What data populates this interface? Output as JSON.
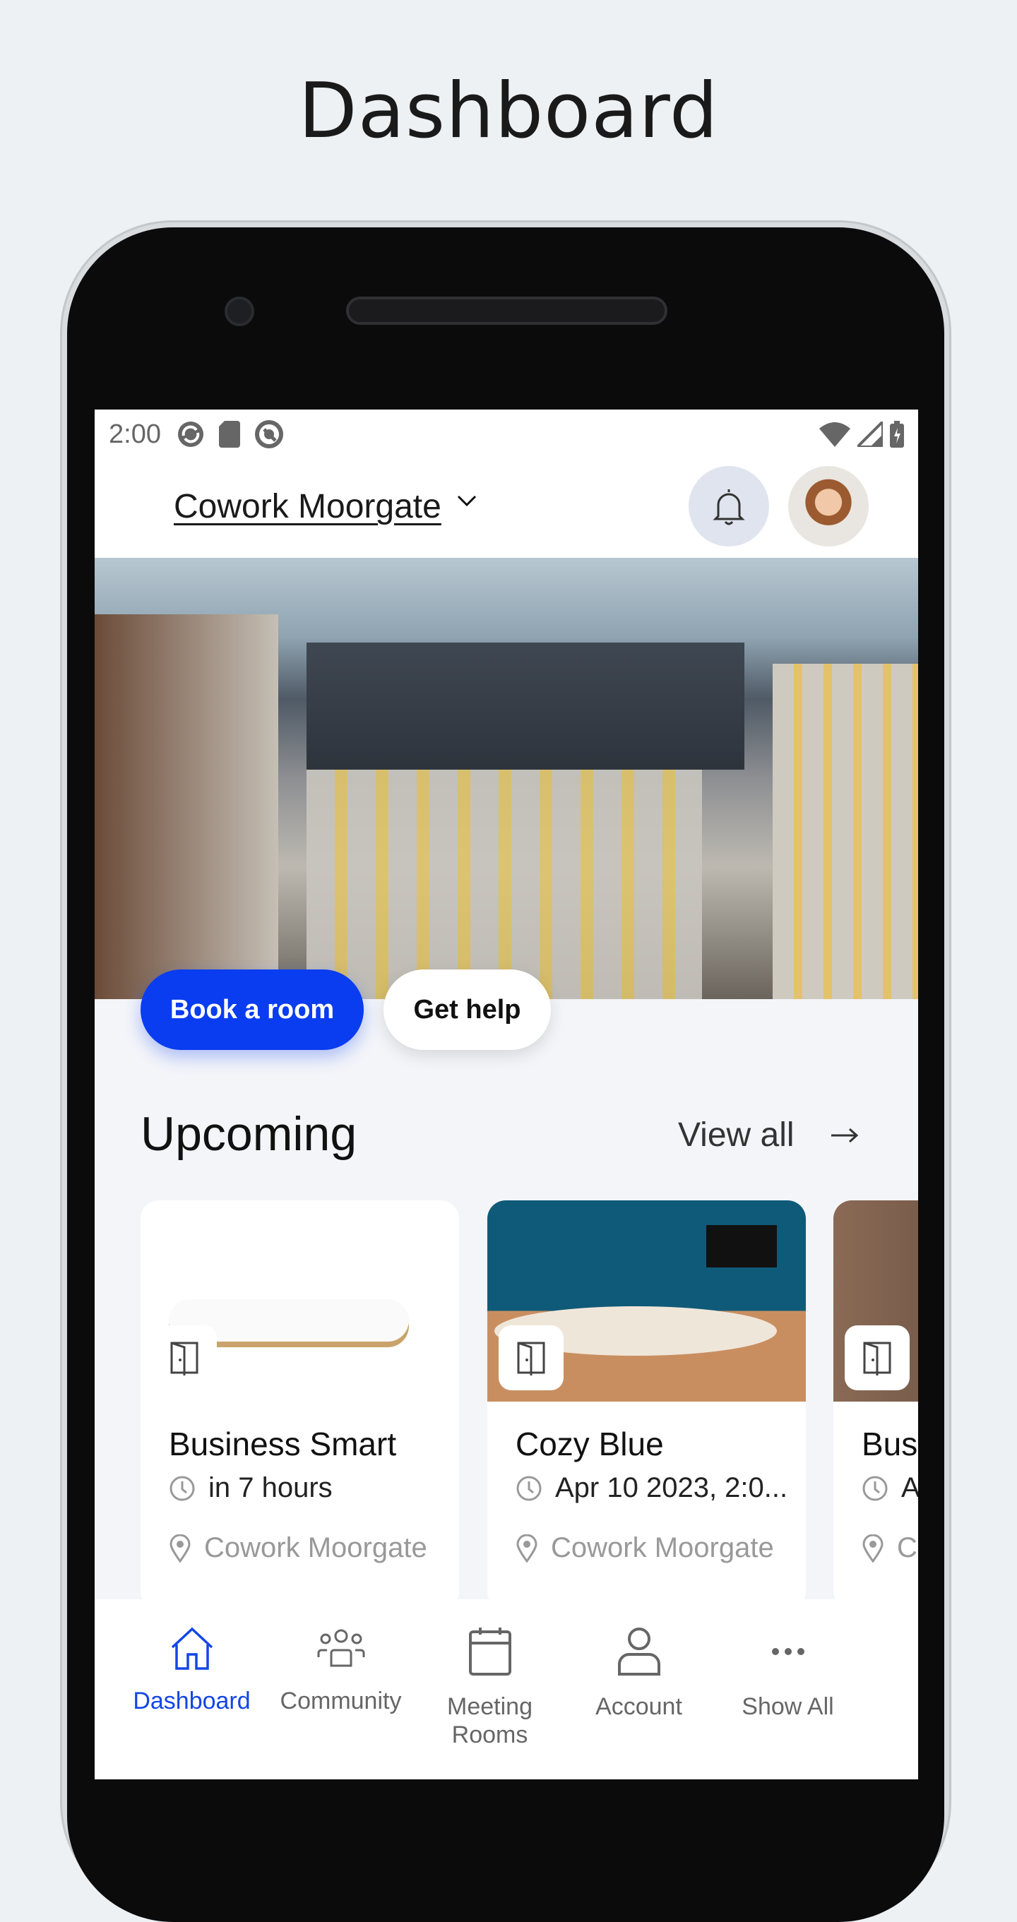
{
  "page_title": "Dashboard",
  "status_bar": {
    "time": "2:00"
  },
  "header": {
    "location": "Cowork Moorgate"
  },
  "actions": {
    "book": "Book a room",
    "help": "Get help"
  },
  "upcoming": {
    "title": "Upcoming",
    "view_all": "View all",
    "cards": [
      {
        "name": "Business Smart",
        "time": "in 7 hours",
        "location": "Cowork Moorgate"
      },
      {
        "name": "Cozy Blue",
        "time": "Apr 10 2023, 2:0...",
        "location": "Cowork Moorgate"
      },
      {
        "name": "Bus",
        "time": "A",
        "location": "C"
      }
    ]
  },
  "nav": [
    {
      "label": "Dashboard",
      "icon": "home-icon",
      "active": true
    },
    {
      "label": "Community",
      "icon": "people-icon"
    },
    {
      "label": "Meeting Rooms",
      "icon": "calendar-icon"
    },
    {
      "label": "Account",
      "icon": "person-icon"
    },
    {
      "label": "Show All",
      "icon": "more-icon"
    }
  ],
  "colors": {
    "accent": "#0a3cf0",
    "nav_active": "#1246e6",
    "background": "#f3f5f9"
  }
}
